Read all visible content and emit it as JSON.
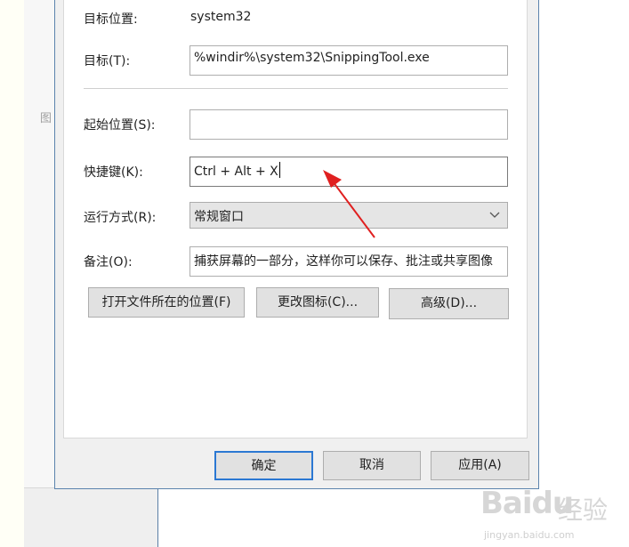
{
  "background": {
    "side_text": "图"
  },
  "dialog": {
    "target_location_label": "目标位置:",
    "target_location_value": "system32",
    "target_label": "目标(T):",
    "target_value": "%windir%\\system32\\SnippingTool.exe",
    "start_in_label": "起始位置(S):",
    "start_in_value": "",
    "shortcut_key_label": "快捷键(K):",
    "shortcut_key_value": "Ctrl + Alt + X",
    "run_label": "运行方式(R):",
    "run_value": "常规窗口",
    "comment_label": "备注(O):",
    "comment_value": "捕获屏幕的一部分，这样你可以保存、批注或共享图像",
    "open_location_button": "打开文件所在的位置(F)",
    "change_icon_button": "更改图标(C)...",
    "advanced_button": "高级(D)...",
    "ok_button": "确定",
    "cancel_button": "取消",
    "apply_button": "应用(A)"
  },
  "watermark": {
    "brand": "Baidu",
    "suffix": "经验",
    "url": "jingyan.baidu.com"
  },
  "colors": {
    "dialog_border": "#5b83ad",
    "default_button_border": "#2b78d3",
    "annotation_arrow": "#e02020"
  }
}
